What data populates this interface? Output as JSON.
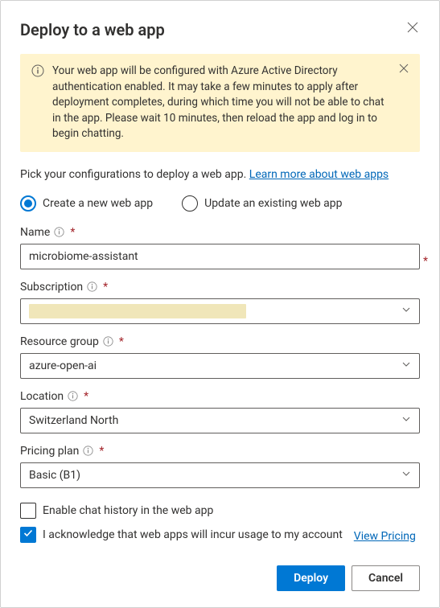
{
  "dialog": {
    "title": "Deploy to a web app"
  },
  "alert": {
    "text": "Your web app will be configured with Azure Active Directory authentication enabled. It may take a few minutes to apply after deployment completes, during which time you will not be able to chat in the app. Please wait 10 minutes, then reload the app and log in to begin chatting."
  },
  "intro": {
    "text": "Pick your configurations to deploy a web app. ",
    "link": "Learn more about web apps"
  },
  "mode": {
    "create_label": "Create a new web app",
    "update_label": "Update an existing web app",
    "selected": "create"
  },
  "fields": {
    "name": {
      "label": "Name",
      "value": "microbiome-assistant"
    },
    "subscription": {
      "label": "Subscription",
      "value": ""
    },
    "resource_group": {
      "label": "Resource group",
      "value": "azure-open-ai"
    },
    "location": {
      "label": "Location",
      "value": "Switzerland North"
    },
    "pricing_plan": {
      "label": "Pricing plan",
      "value": "Basic (B1)"
    }
  },
  "options": {
    "enable_history_label": "Enable chat history in the web app",
    "enable_history_checked": false,
    "acknowledge_label": "I acknowledge that web apps will incur usage to my account",
    "acknowledge_checked": true,
    "view_pricing_label": "View Pricing"
  },
  "footer": {
    "deploy_label": "Deploy",
    "cancel_label": "Cancel"
  }
}
